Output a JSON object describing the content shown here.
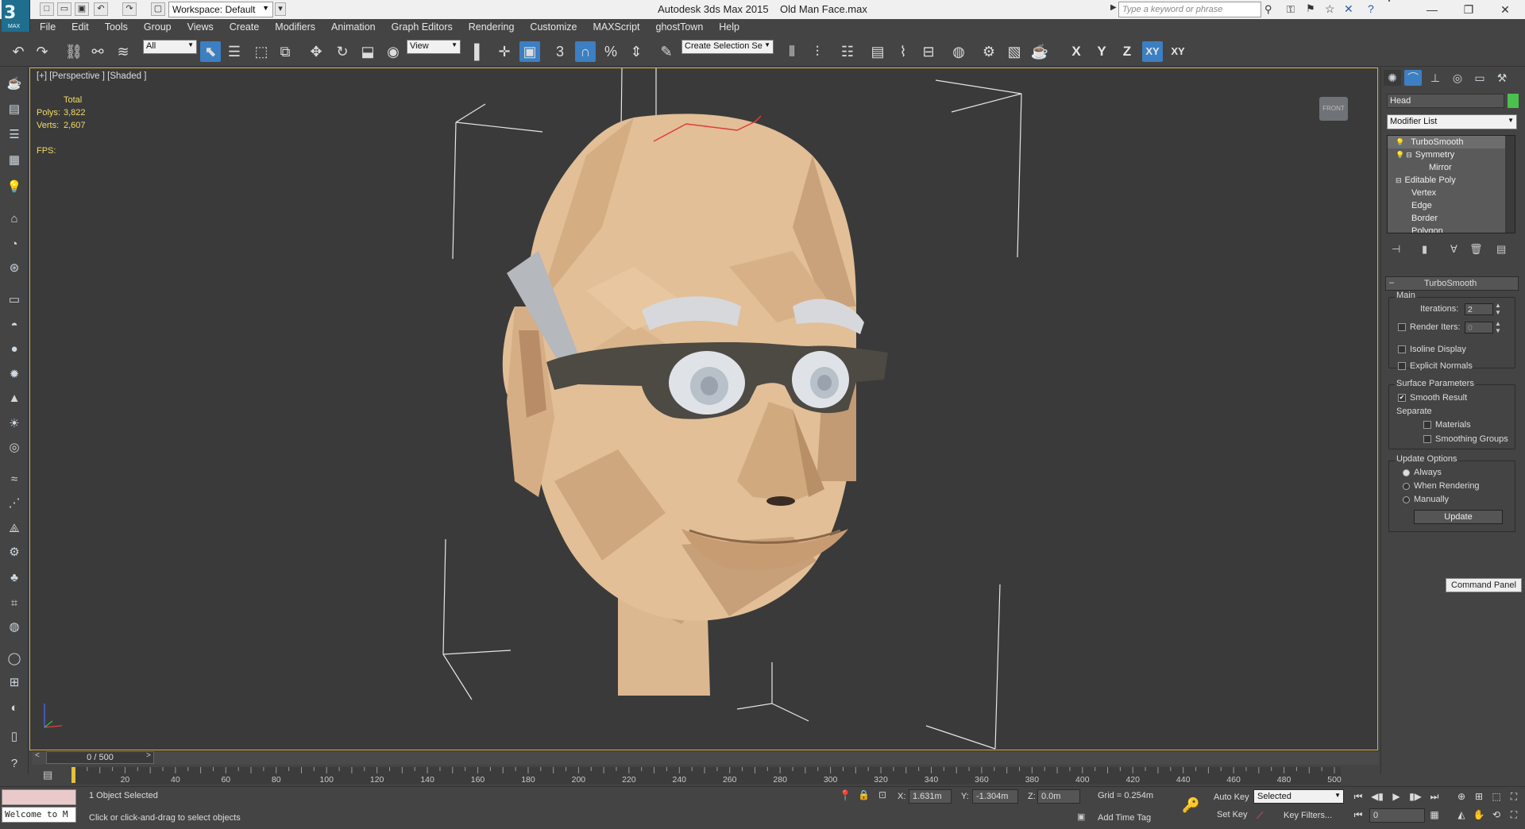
{
  "app": {
    "logo_text": "MAX",
    "title_app": "Autodesk 3ds Max  2015",
    "title_file": "Old Man Face.max",
    "workspace": "Workspace: Default",
    "search_placeholder": "Type a keyword or phrase"
  },
  "menu": [
    "File",
    "Edit",
    "Tools",
    "Group",
    "Views",
    "Create",
    "Modifiers",
    "Animation",
    "Graph Editors",
    "Rendering",
    "Customize",
    "MAXScript",
    "ghostTown",
    "Help"
  ],
  "toolbar": {
    "selection_filter": "All",
    "ref_coord": "View",
    "named_selection": "Create Selection Se",
    "snap_label": "3",
    "axis": {
      "x": "X",
      "y": "Y",
      "z": "Z",
      "xy": "XY",
      "xy2": "XY"
    }
  },
  "viewport": {
    "label": "[+] [Perspective ] [Shaded ]",
    "stats_header": "Total",
    "polys_label": "Polys:",
    "polys_value": "3,822",
    "verts_label": "Verts:",
    "verts_value": "2,607",
    "fps_label": "FPS:",
    "viewcube_label": "FRONT"
  },
  "command_panel": {
    "object_name": "Head",
    "object_color": "#4cc04c",
    "modifier_list": "Modifier List",
    "stack": [
      {
        "label": "TurboSmooth",
        "indent": 0,
        "selected": true
      },
      {
        "label": "Symmetry",
        "indent": 1,
        "selected": false
      },
      {
        "label": "Mirror",
        "indent": 2,
        "selected": false
      },
      {
        "label": "Editable Poly",
        "indent": 0,
        "selected": false
      },
      {
        "label": "Vertex",
        "indent": 1,
        "selected": false
      },
      {
        "label": "Edge",
        "indent": 1,
        "selected": false
      },
      {
        "label": "Border",
        "indent": 1,
        "selected": false
      },
      {
        "label": "Polygon",
        "indent": 1,
        "selected": false
      }
    ],
    "rollout_title": "TurboSmooth",
    "main_label": "Main",
    "iterations_label": "Iterations:",
    "iterations_value": "2",
    "render_iters_label": "Render Iters:",
    "render_iters_value": "0",
    "isoline_label": "Isoline Display",
    "explicit_normals_label": "Explicit Normals",
    "surface_params_label": "Surface Parameters",
    "smooth_result_label": "Smooth Result",
    "separate_label": "Separate",
    "materials_label": "Materials",
    "smoothing_groups_label": "Smoothing Groups",
    "update_options_label": "Update Options",
    "always_label": "Always",
    "when_rendering_label": "When Rendering",
    "manually_label": "Manually",
    "update_button": "Update",
    "tooltip": "Command Panel"
  },
  "timeline": {
    "slider_text": "0 / 500",
    "ticks": [
      "20",
      "40",
      "60",
      "80",
      "100",
      "120",
      "140",
      "160",
      "180",
      "200",
      "220",
      "240",
      "260",
      "280",
      "300",
      "320",
      "340",
      "360",
      "380",
      "400",
      "420",
      "440",
      "460",
      "480",
      "500"
    ]
  },
  "status": {
    "selected_text": "1 Object Selected",
    "prompt_text": "Click or click-and-drag to select objects",
    "maxscript_text": "Welcome to M",
    "x_label": "X:",
    "x_value": "1.631m",
    "y_label": "Y:",
    "y_value": "-1.304m",
    "z_label": "Z:",
    "z_value": "0.0m",
    "grid": "Grid = 0.254m",
    "add_time_tag": "Add Time Tag",
    "auto_key": "Auto Key",
    "set_key": "Set Key",
    "key_mode": "Selected",
    "key_filters": "Key Filters...",
    "frame_value": "0"
  }
}
